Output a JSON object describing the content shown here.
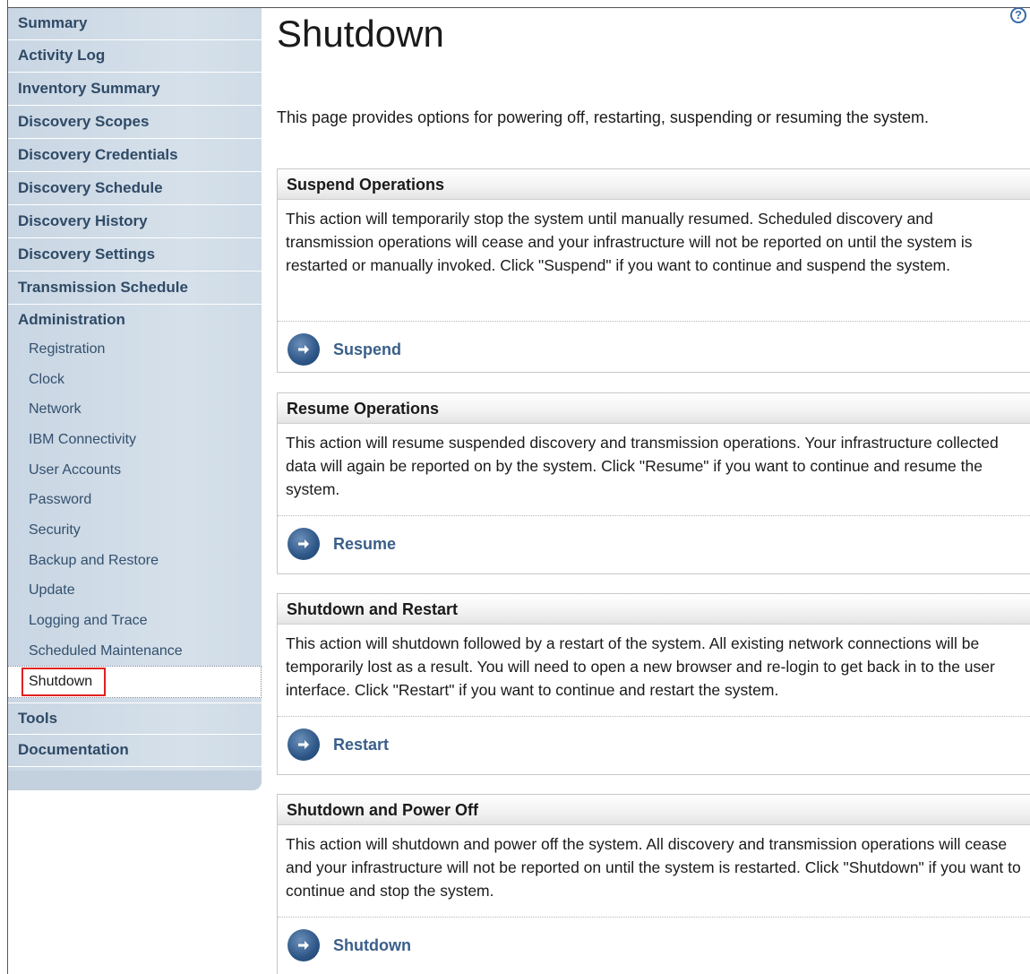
{
  "sidebar": {
    "nav": [
      "Summary",
      "Activity Log",
      "Inventory Summary",
      "Discovery Scopes",
      "Discovery Credentials",
      "Discovery Schedule",
      "Discovery History",
      "Discovery Settings",
      "Transmission Schedule",
      "Administration"
    ],
    "admin_items": [
      "Registration",
      "Clock",
      "Network",
      "IBM Connectivity",
      "User Accounts",
      "Password",
      "Security",
      "Backup and Restore",
      "Update",
      "Logging and Trace",
      "Scheduled Maintenance"
    ],
    "selected_item": "Shutdown",
    "bottom_nav": [
      "Tools",
      "Documentation"
    ]
  },
  "page": {
    "title": "Shutdown",
    "help_icon_label": "?",
    "intro": "This page provides options for powering off, restarting, suspending or resuming the system."
  },
  "sections": [
    {
      "title": "Suspend Operations",
      "body": "This action will temporarily stop the system until manually resumed. Scheduled discovery and transmission operations will cease and your infrastructure will not be reported on until the system is restarted or manually invoked. Click \"Suspend\" if you want to continue and suspend the system.",
      "action": "Suspend"
    },
    {
      "title": "Resume Operations",
      "body": "This action will resume suspended discovery and transmission operations. Your infrastructure collected data will again be reported on by the system. Click \"Resume\" if you want to continue and resume the system.",
      "action": "Resume"
    },
    {
      "title": "Shutdown and Restart",
      "body": "This action will shutdown followed by a restart of the system. All existing network connections will be temporarily lost as a result. You will need to open a new browser and re-login to get back in to the user interface. Click \"Restart\" if you want to continue and restart the system.",
      "action": "Restart"
    },
    {
      "title": "Shutdown and Power Off",
      "body": "This action will shutdown and power off the system. All discovery and transmission operations will cease and your infrastructure will not be reported on until the system is restarted. Click \"Shutdown\" if you want to continue and stop the system.",
      "action": "Shutdown"
    }
  ]
}
